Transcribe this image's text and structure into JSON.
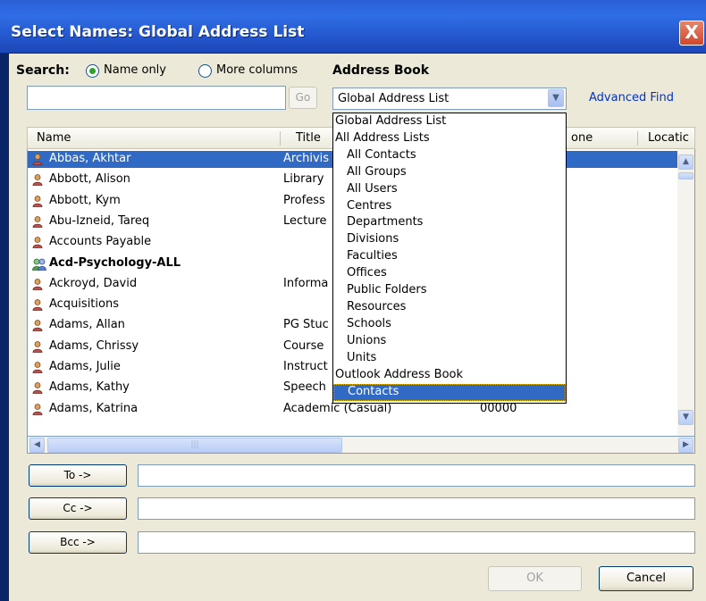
{
  "window": {
    "title": "Select Names: Global Address List",
    "close_glyph": "X"
  },
  "search": {
    "label": "Search:",
    "option_name_only": "Name only",
    "option_more_columns": "More columns",
    "selected_option": "Name only",
    "input_value": "",
    "go_label": "Go"
  },
  "address_book": {
    "label": "Address Book",
    "selected": "Global Address List",
    "advanced_find": "Advanced Find",
    "options": [
      {
        "label": "Global Address List",
        "indent": false
      },
      {
        "label": "All Address Lists",
        "indent": false
      },
      {
        "label": "All Contacts",
        "indent": true
      },
      {
        "label": "All Groups",
        "indent": true
      },
      {
        "label": "All Users",
        "indent": true
      },
      {
        "label": "Centres",
        "indent": true
      },
      {
        "label": "Departments",
        "indent": true
      },
      {
        "label": "Divisions",
        "indent": true
      },
      {
        "label": "Faculties",
        "indent": true
      },
      {
        "label": "Offices",
        "indent": true
      },
      {
        "label": "Public Folders",
        "indent": true
      },
      {
        "label": "Resources",
        "indent": true
      },
      {
        "label": "Schools",
        "indent": true
      },
      {
        "label": "Unions",
        "indent": true
      },
      {
        "label": "Units",
        "indent": true
      },
      {
        "label": "Outlook Address Book",
        "indent": false
      },
      {
        "label": "Contacts",
        "indent": true,
        "highlighted": true
      }
    ]
  },
  "columns": {
    "name": "Name",
    "title": "Title",
    "phone": "one",
    "location": "Locatic"
  },
  "rows": [
    {
      "name": "Abbas, Akhtar",
      "title": "Archivis",
      "phone": "",
      "bold": false,
      "group": false,
      "selected": true
    },
    {
      "name": "Abbott, Alison",
      "title": "Library",
      "phone": "",
      "bold": false,
      "group": false,
      "selected": false
    },
    {
      "name": "Abbott, Kym",
      "title": "Profess",
      "phone": "",
      "bold": false,
      "group": false,
      "selected": false
    },
    {
      "name": "Abu-Izneid, Tareq",
      "title": "Lecture",
      "phone": "",
      "bold": false,
      "group": false,
      "selected": false
    },
    {
      "name": "Accounts Payable",
      "title": "",
      "phone": "",
      "bold": false,
      "group": false,
      "selected": false
    },
    {
      "name": "Acd-Psychology-ALL",
      "title": "",
      "phone": "",
      "bold": true,
      "group": true,
      "selected": false
    },
    {
      "name": "Ackroyd, David",
      "title": "Informa",
      "phone": "",
      "bold": false,
      "group": false,
      "selected": false
    },
    {
      "name": "Acquisitions",
      "title": "",
      "phone": "",
      "bold": false,
      "group": false,
      "selected": false
    },
    {
      "name": "Adams, Allan",
      "title": "PG Stuc",
      "phone": "",
      "bold": false,
      "group": false,
      "selected": false
    },
    {
      "name": "Adams, Chrissy",
      "title": "Course",
      "phone": "",
      "bold": false,
      "group": false,
      "selected": false
    },
    {
      "name": "Adams, Julie",
      "title": "Instruct",
      "phone": "",
      "bold": false,
      "group": false,
      "selected": false
    },
    {
      "name": "Adams, Kathy",
      "title": "Speech",
      "phone": "",
      "bold": false,
      "group": false,
      "selected": false
    },
    {
      "name": "Adams, Katrina",
      "title": "Academic (Casual)",
      "phone": "00000",
      "bold": false,
      "group": false,
      "selected": false
    }
  ],
  "recipients": {
    "to_label": "To ->",
    "cc_label": "Cc ->",
    "bcc_label": "Bcc ->",
    "to_value": "",
    "cc_value": "",
    "bcc_value": ""
  },
  "footer": {
    "ok_label": "OK",
    "cancel_label": "Cancel"
  },
  "colors": {
    "titlebar": "#2456cc",
    "selection": "#316ac5",
    "dialog_bg": "#ece9d8"
  },
  "icons": {
    "person": "person-icon",
    "group": "group-icon",
    "close": "close-icon",
    "dropdown": "chevron-down-icon"
  }
}
